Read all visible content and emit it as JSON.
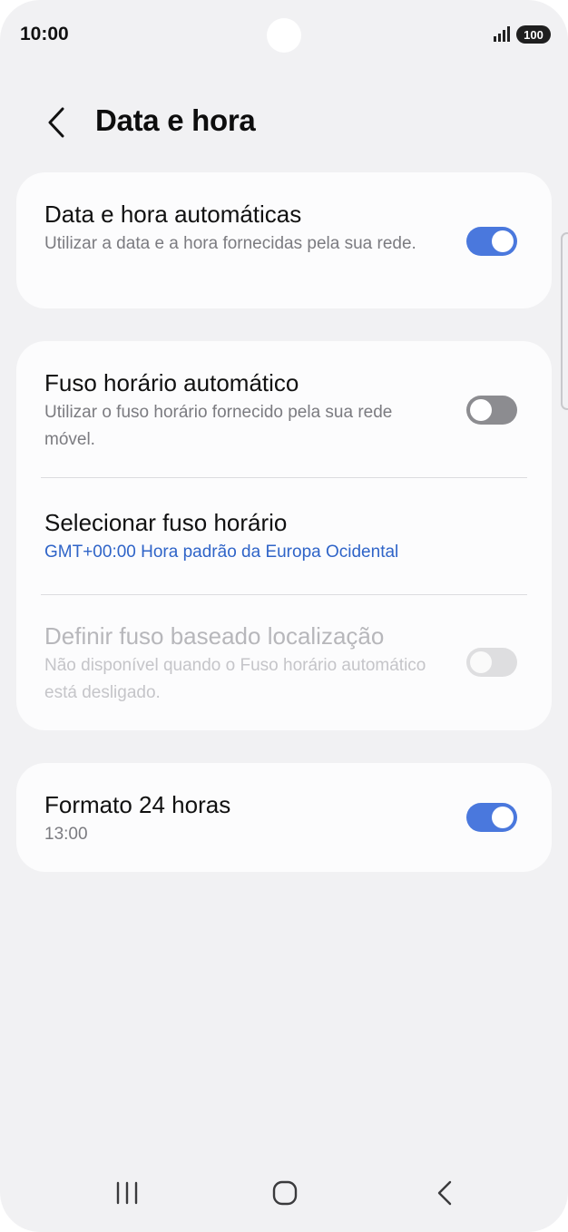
{
  "status_bar": {
    "time": "10:00",
    "battery": "100",
    "signal_icon": "signal-bars-icon"
  },
  "header": {
    "title": "Data e hora",
    "back_icon": "chevron-left-icon"
  },
  "sections": {
    "auto_datetime": {
      "title": "Data e hora automáticas",
      "subtitle": "Utilizar a data e a hora fornecidas pela sua rede.",
      "enabled": true
    },
    "auto_timezone": {
      "title": "Fuso horário automático",
      "subtitle": "Utilizar o fuso horário fornecido pela sua rede móvel.",
      "enabled": false
    },
    "select_timezone": {
      "title": "Selecionar fuso horário",
      "value": "GMT+00:00 Hora padrão da Europa Ocidental"
    },
    "location_timezone": {
      "title": "Definir fuso baseado localização",
      "subtitle": "Não disponível quando o Fuso horário automático está desligado.",
      "enabled": false,
      "disabled": true
    },
    "format_24h": {
      "title": "Formato 24 horas",
      "subtitle": "13:00",
      "enabled": true
    }
  },
  "nav_bar": {
    "recents_icon": "recents-icon",
    "home_icon": "home-icon",
    "back_icon": "back-icon"
  },
  "colors": {
    "accent": "#4a78dd",
    "link": "#2f64c8",
    "background": "#f1f1f3",
    "card": "#fcfcfd"
  }
}
